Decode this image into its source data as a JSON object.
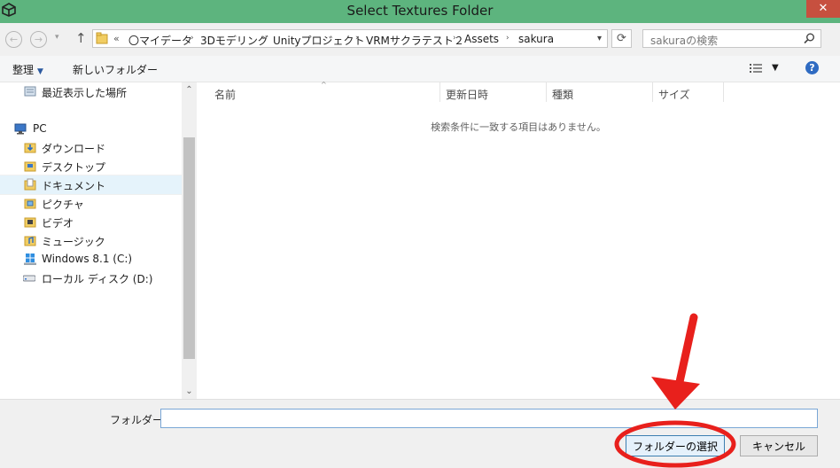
{
  "window": {
    "title": "Select Textures Folder",
    "close_glyph": "✕"
  },
  "address": {
    "recent_glyph": "▾",
    "up_glyph": "↑",
    "chevron": "«",
    "breadcrumbs": [
      "〇マイデータ",
      "3Dモデリング",
      "Unityプロジェクト",
      "VRMサクラテスト２",
      "Assets",
      "sakura"
    ],
    "separator_glyph": "›",
    "refresh_glyph": "⟳",
    "search_placeholder": "sakuraの検索"
  },
  "toolbar": {
    "organize_label": "整理",
    "new_folder_label": "新しいフォルダー",
    "help_glyph": "?"
  },
  "nav": {
    "items": [
      {
        "label": "最近表示した場所",
        "icon": "recent-places-icon"
      },
      {
        "label": "PC",
        "icon": "computer-icon"
      },
      {
        "label": "ダウンロード",
        "icon": "downloads-folder-icon"
      },
      {
        "label": "デスクトップ",
        "icon": "desktop-folder-icon"
      },
      {
        "label": "ドキュメント",
        "icon": "documents-folder-icon"
      },
      {
        "label": "ピクチャ",
        "icon": "pictures-folder-icon"
      },
      {
        "label": "ビデオ",
        "icon": "videos-folder-icon"
      },
      {
        "label": "ミュージック",
        "icon": "music-folder-icon"
      },
      {
        "label": "Windows 8.1 (C:)",
        "icon": "windows-drive-icon"
      },
      {
        "label": "ローカル ディスク (D:)",
        "icon": "local-disk-icon"
      }
    ],
    "selected_index": 4
  },
  "content": {
    "columns": [
      "名前",
      "更新日時",
      "種類",
      "サイズ"
    ],
    "empty_message": "検索条件に一致する項目はありません。"
  },
  "bottom": {
    "folder_label": "フォルダー:",
    "folder_value": "",
    "select_button": "フォルダーの選択",
    "cancel_button": "キャンセル"
  },
  "colors": {
    "title_bar": "#5db47e",
    "close_button": "#c7503f",
    "annotation_red": "#e8201c"
  }
}
